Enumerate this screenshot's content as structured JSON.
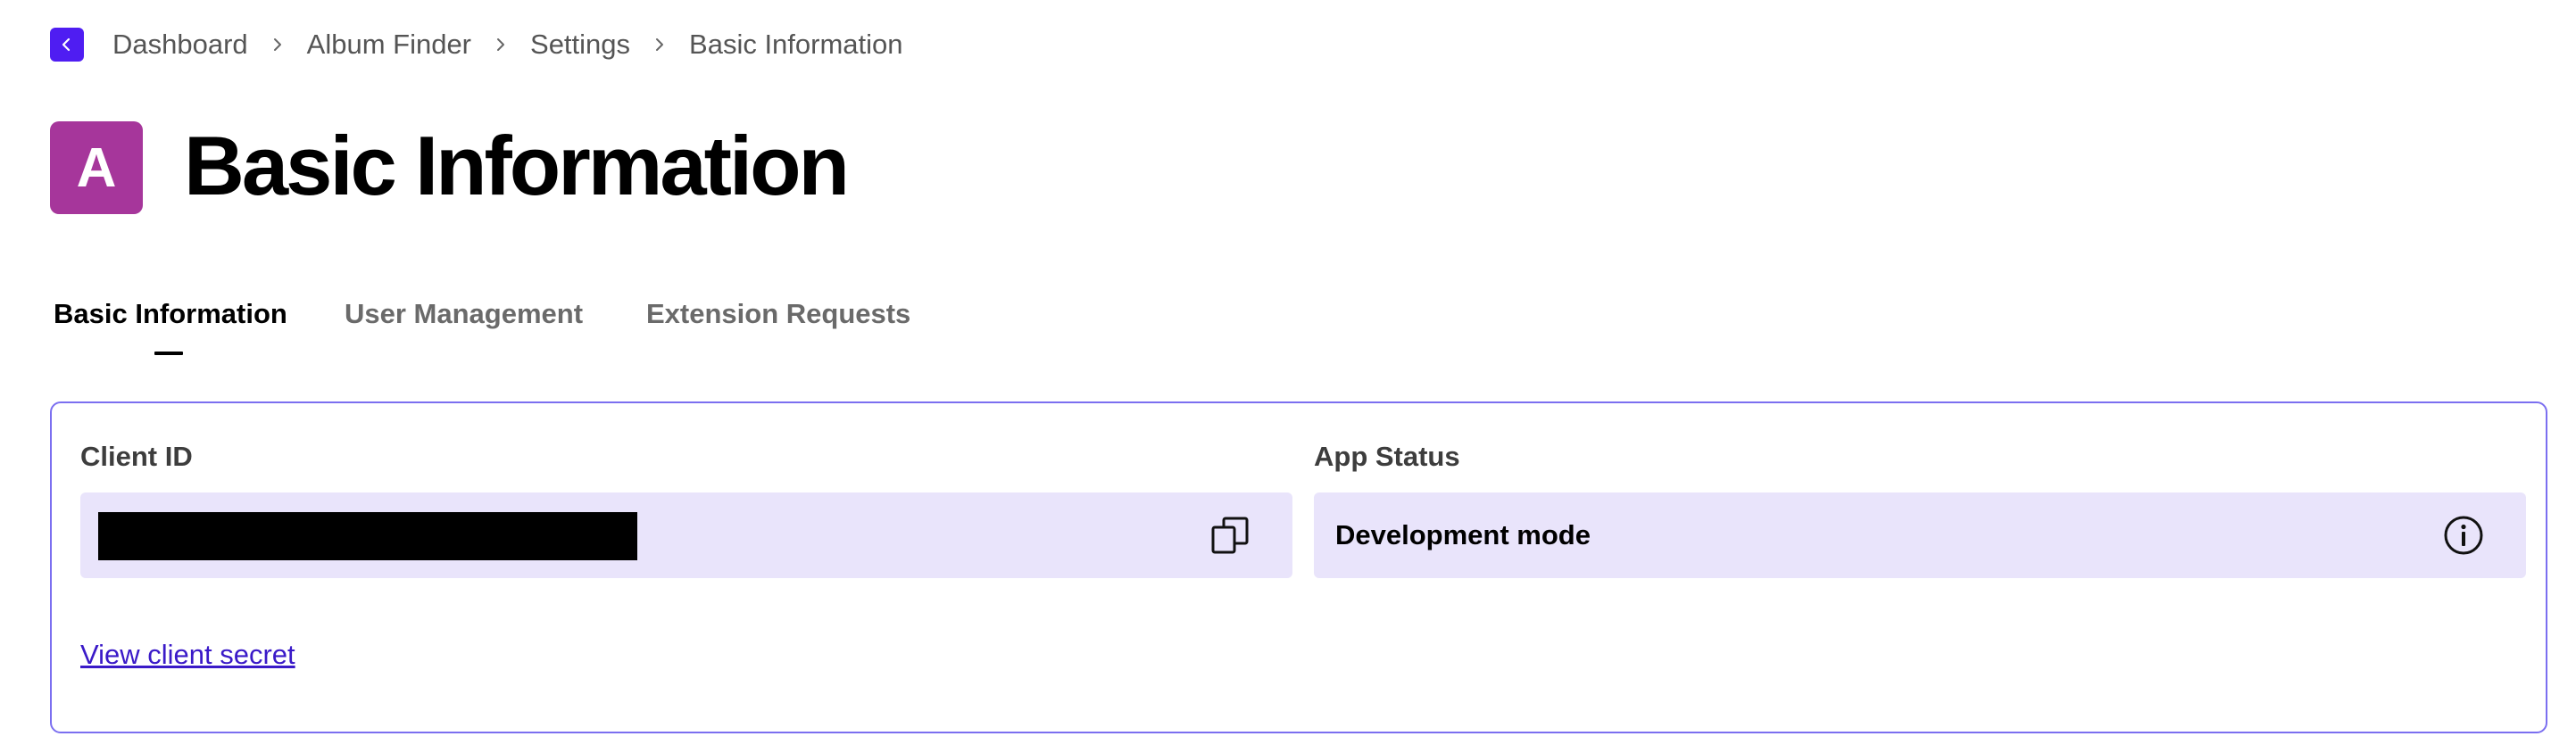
{
  "breadcrumb": {
    "items": [
      {
        "label": "Dashboard"
      },
      {
        "label": "Album Finder"
      },
      {
        "label": "Settings"
      },
      {
        "label": "Basic Information"
      }
    ],
    "back_icon": "chevron-left-icon",
    "separator_icon": "chevron-right-icon"
  },
  "header": {
    "avatar_letter": "A",
    "avatar_color": "#a6369b",
    "title": "Basic Information"
  },
  "tabs": [
    {
      "label": "Basic Information",
      "active": true
    },
    {
      "label": "User Management",
      "active": false
    },
    {
      "label": "Extension Requests",
      "active": false
    }
  ],
  "card": {
    "client_id": {
      "label": "Client ID",
      "value_redacted": true,
      "copy_icon": "copy-icon"
    },
    "app_status": {
      "label": "App Status",
      "value": "Development mode",
      "info_icon": "info-icon"
    },
    "secret_link": "View client secret"
  },
  "colors": {
    "accent": "#4f1df2",
    "link": "#3a1ac8",
    "field_background": "#e9e4fb",
    "card_border": "#7b6ff0"
  }
}
